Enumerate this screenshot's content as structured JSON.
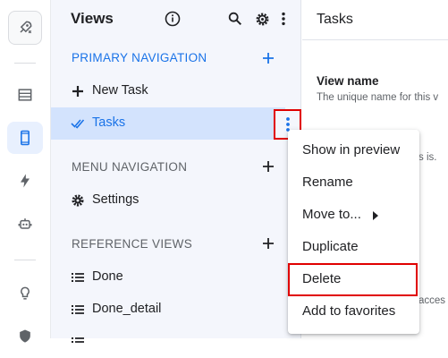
{
  "rail": {
    "items": [
      {
        "name": "app-logo-icon"
      },
      {
        "name": "table-icon"
      },
      {
        "name": "mobile-icon"
      },
      {
        "name": "bolt-icon"
      },
      {
        "name": "robot-icon"
      },
      {
        "name": "lightbulb-icon"
      },
      {
        "name": "shield-icon"
      }
    ]
  },
  "panel": {
    "title": "Views",
    "sections": {
      "primary": {
        "label": "PRIMARY NAVIGATION"
      },
      "menu": {
        "label": "MENU NAVIGATION"
      },
      "reference": {
        "label": "REFERENCE VIEWS"
      }
    },
    "items": {
      "new_task": "New Task",
      "tasks": "Tasks",
      "settings": "Settings",
      "done": "Done",
      "done_detail": "Done_detail"
    }
  },
  "main": {
    "title": "Tasks",
    "view_name_label": "View name",
    "view_name_help": "The unique name for this v",
    "fragment_1": "s is.",
    "fragment_2": "acces"
  },
  "context_menu": {
    "items": [
      "Show in preview",
      "Rename",
      "Move to...",
      "Duplicate",
      "Delete",
      "Add to favorites"
    ]
  },
  "colors": {
    "accent": "#1a73e8",
    "highlight_border": "#e00000",
    "selected_bg": "#d3e3fd",
    "panel_bg": "#f4f6fc"
  }
}
